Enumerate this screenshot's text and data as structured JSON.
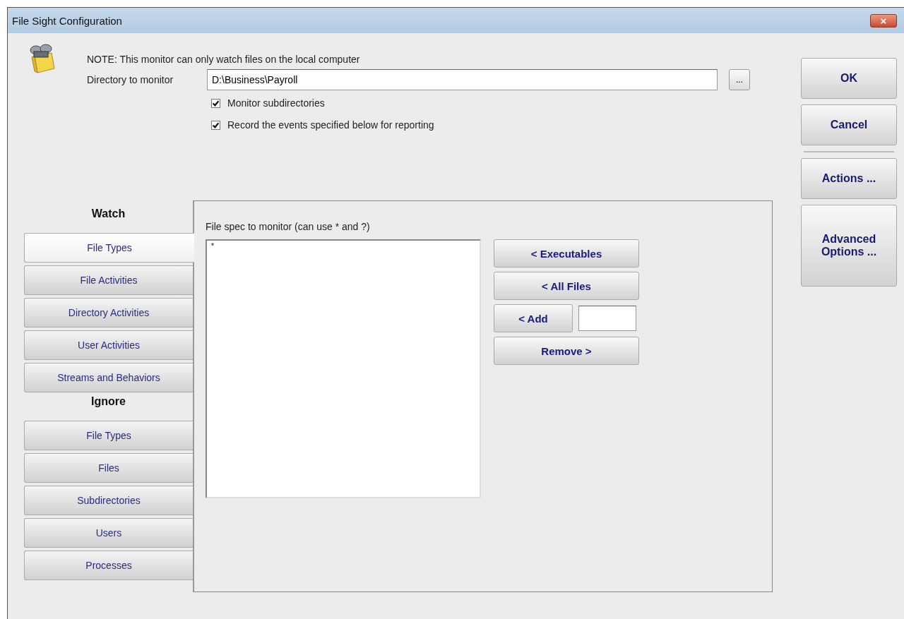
{
  "window": {
    "title": "File Sight Configuration",
    "close": "×"
  },
  "note": "NOTE: This monitor can only watch files on the local computer",
  "directory": {
    "label": "Directory to monitor",
    "value": "D:\\Business\\Payroll",
    "browse": "..."
  },
  "options": [
    {
      "label": "Monitor subdirectories",
      "checked": true
    },
    {
      "label": "Record the events specified below for reporting",
      "checked": true
    }
  ],
  "groups": [
    {
      "heading": "Watch",
      "tabs": [
        {
          "label": "File Types",
          "selected": true
        },
        {
          "label": "File Activities",
          "selected": false
        },
        {
          "label": "Directory Activities",
          "selected": false
        },
        {
          "label": "User Activities",
          "selected": false
        },
        {
          "label": "Streams and Behaviors",
          "selected": false
        }
      ]
    },
    {
      "heading": "Ignore",
      "tabs": [
        {
          "label": "File Types",
          "selected": false
        },
        {
          "label": "Files",
          "selected": false
        },
        {
          "label": "Subdirectories",
          "selected": false
        },
        {
          "label": "Users",
          "selected": false
        },
        {
          "label": "Processes",
          "selected": false
        }
      ]
    }
  ],
  "panel": {
    "label": "File spec to monitor (can use * and ?)",
    "items": [
      "*"
    ],
    "buttons": [
      {
        "label": "< Executables",
        "kind": "button"
      },
      {
        "label": "< All Files",
        "kind": "button"
      },
      {
        "label": "< Add",
        "kind": "button-with-field"
      },
      {
        "label": "Remove >",
        "kind": "button"
      }
    ]
  },
  "side_buttons": [
    {
      "label": "OK",
      "kind": "button"
    },
    {
      "label": "Cancel",
      "kind": "button"
    },
    {
      "kind": "separator"
    },
    {
      "label": "Actions ...",
      "kind": "button"
    },
    {
      "label": "Advanced Options ...",
      "kind": "tall"
    }
  ]
}
